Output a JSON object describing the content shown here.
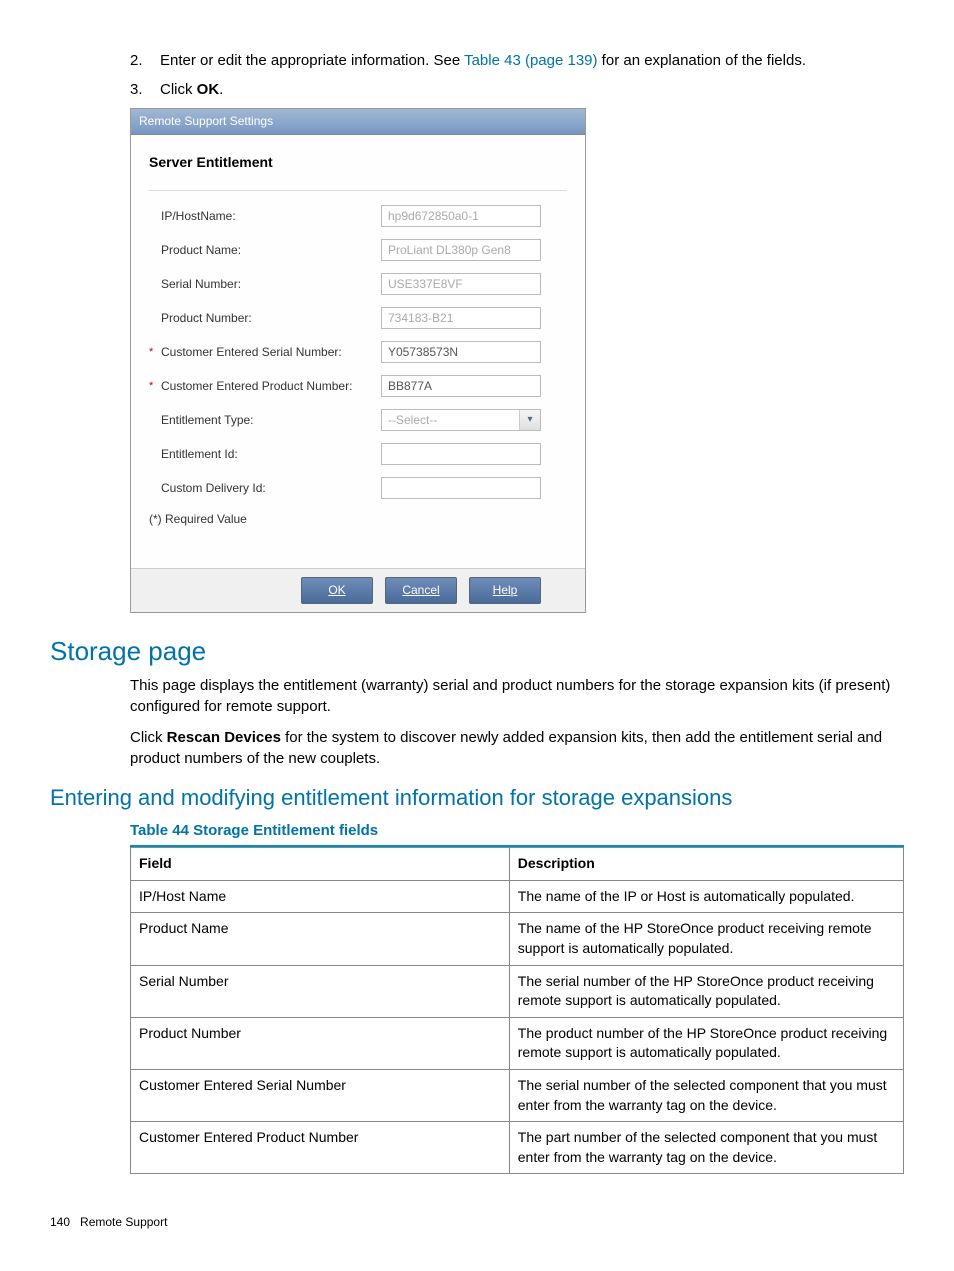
{
  "steps": {
    "s2": {
      "num": "2.",
      "text_a": "Enter or edit the appropriate information. See ",
      "link": "Table 43 (page 139)",
      "text_b": " for an explanation of the fields."
    },
    "s3": {
      "num": "3.",
      "text_a": "Click ",
      "bold": "OK",
      "text_b": "."
    }
  },
  "dialog": {
    "title": "Remote Support Settings",
    "panel_title": "Server Entitlement",
    "fields": {
      "ip": {
        "label": "IP/HostName:",
        "value": "hp9d672850a0-1",
        "required": ""
      },
      "pname": {
        "label": "Product Name:",
        "value": "ProLiant DL380p Gen8",
        "required": ""
      },
      "serial": {
        "label": "Serial Number:",
        "value": "USE337E8VF",
        "required": ""
      },
      "pnum": {
        "label": "Product Number:",
        "value": "734183-B21",
        "required": ""
      },
      "cserial": {
        "label": "Customer Entered Serial Number:",
        "value": "Y05738573N",
        "required": "*"
      },
      "cpnum": {
        "label": "Customer Entered Product Number:",
        "value": "BB877A",
        "required": "*"
      },
      "etype": {
        "label": "Entitlement Type:",
        "value": "--Select--",
        "required": ""
      },
      "eid": {
        "label": "Entitlement Id:",
        "value": "",
        "required": ""
      },
      "cdid": {
        "label": "Custom Delivery Id:",
        "value": "",
        "required": ""
      }
    },
    "required_note": "(*) Required Value",
    "buttons": {
      "ok": "OK",
      "cancel": "Cancel",
      "help": "Help"
    }
  },
  "sections": {
    "storage_title": "Storage page",
    "storage_p1": "This page displays the entitlement (warranty) serial and product numbers for the storage expansion kits (if present) configured for remote support.",
    "storage_p2a": "Click ",
    "storage_p2bold": "Rescan Devices",
    "storage_p2b": " for the system to discover newly added expansion kits, then add the entitlement serial and product numbers of the new couplets.",
    "subsection_title": "Entering and modifying entitlement information for storage expansions",
    "table_caption": "Table 44 Storage Entitlement fields"
  },
  "table": {
    "headers": {
      "field": "Field",
      "desc": "Description"
    },
    "rows": [
      {
        "field": "IP/Host Name",
        "desc": "The name of the IP or Host is automatically populated."
      },
      {
        "field": "Product Name",
        "desc": "The name of the HP StoreOnce product receiving remote support is automatically populated."
      },
      {
        "field": "Serial Number",
        "desc": "The serial number of the HP StoreOnce product receiving remote support is automatically populated."
      },
      {
        "field": "Product Number",
        "desc": "The product number of the HP StoreOnce product receiving remote support is automatically populated."
      },
      {
        "field": "Customer Entered Serial Number",
        "desc": "The serial number of the selected component that you must enter from the warranty tag on the device."
      },
      {
        "field": "Customer Entered Product Number",
        "desc": "The part number of the selected component that you must enter from the warranty tag on the device."
      }
    ]
  },
  "footer": {
    "page": "140",
    "section": "Remote Support"
  }
}
